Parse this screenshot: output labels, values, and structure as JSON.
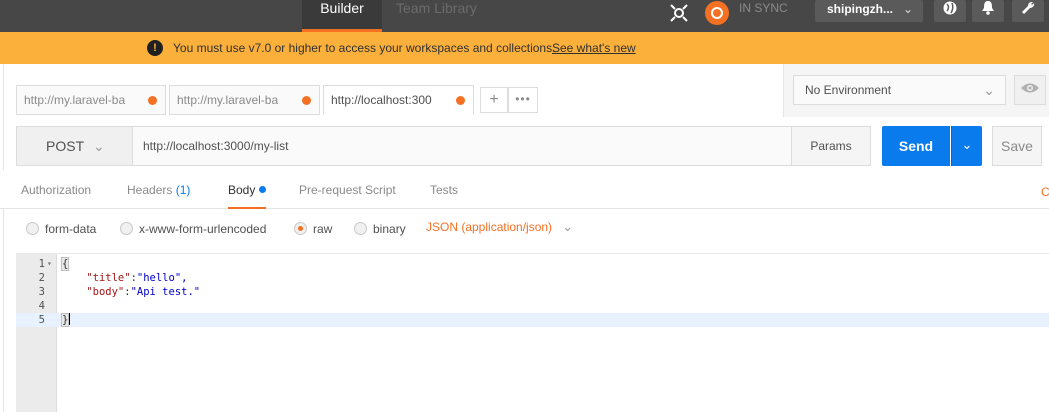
{
  "topbar": {
    "tabs": [
      "Builder",
      "Team Library"
    ],
    "sync_label": "IN SYNC",
    "user_name": "shipingzh...",
    "colors": {
      "bg": "#474747",
      "accent": "#f47023"
    }
  },
  "banner": {
    "message": "You must use v7.0 or higher to access your workspaces and collections.",
    "link": "See what's new",
    "color": "#fbb03b"
  },
  "request_tabs": [
    {
      "label": "http://my.laravel-ba",
      "unsaved": true
    },
    {
      "label": "http://my.laravel-ba",
      "unsaved": true
    },
    {
      "label": "http://localhost:300",
      "unsaved": true
    }
  ],
  "add_tab_label": "+",
  "more_tabs_label": "•••",
  "environment": {
    "selected": "No Environment"
  },
  "request": {
    "method": "POST",
    "url": "http://localhost:3000/my-list",
    "params_label": "Params",
    "send_label": "Send",
    "save_label": "Save",
    "send_color": "#097bed"
  },
  "subtabs": {
    "authorization": "Authorization",
    "headers": "Headers",
    "headers_count": "(1)",
    "body": "Body",
    "prerequest": "Pre-request Script",
    "tests": "Tests",
    "cookies_partial": "C"
  },
  "body_types": {
    "form_data": "form-data",
    "urlencoded": "x-www-form-urlencoded",
    "raw": "raw",
    "binary": "binary",
    "selected": "raw",
    "content_type": "JSON (application/json)"
  },
  "editor": {
    "lines": [
      {
        "num": "1",
        "text": "{"
      },
      {
        "num": "2",
        "key": "\"title\"",
        "value": "\"hello\","
      },
      {
        "num": "3",
        "key": "\"body\"",
        "value": "\"Api test.\""
      },
      {
        "num": "4",
        "text": ""
      },
      {
        "num": "5",
        "text": "}"
      }
    ]
  }
}
